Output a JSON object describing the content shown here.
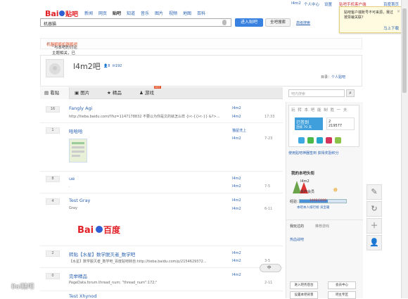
{
  "userbar": {
    "user": "l4m2",
    "center": "个人中心",
    "settings": "设置",
    "client": "贴吧手机客户端",
    "home": "百度首页"
  },
  "logo": {
    "text": "Bai贴吧"
  },
  "nav": [
    "新闻",
    "网页",
    "贴吧",
    "知道",
    "音乐",
    "图片",
    "视频",
    "地图",
    "百科"
  ],
  "search": {
    "value": "机器猫",
    "enter_label": "进入贴吧",
    "all_label": "全吧搜索",
    "advanced": "高级搜索"
  },
  "tip": {
    "text": "贴吧客户端账号不可来源，赛过按票裁关联?",
    "close": "×",
    "go": "马上下载"
  },
  "notice": {
    "prefix": "“",
    "highlight": "机器鹂鹂",
    "text": "”与本吧的讨论主题相关，已为您自动跳转；若您寻找的不是本吧，也可以创建",
    "link": "机器鹂吧",
    "close": "×"
  },
  "forum": {
    "name": "l4m2吧",
    "members": "8",
    "posts": "192",
    "dir_label": "目录：",
    "dir_value": "个人贴吧"
  },
  "tabs": {
    "posts": "看贴",
    "pics": "图片",
    "good": "精品",
    "game": "游戏",
    "hot": "HOT"
  },
  "post_search": {
    "placeholder": "吧内搜索",
    "icon": "search-icon"
  },
  "threads": [
    {
      "reply": "16",
      "title": "Fangly Agi",
      "abstract": "http://tieba.baidu.com/f?kz=1147178832 不要以为你是文的就怎么样 {i<-{{i<-}} &?>...",
      "author": "l4m2",
      "last": "l4m2",
      "time": "17:33"
    },
    {
      "reply": "1",
      "title": "哈哈哈",
      "abstract": "",
      "author": "猫屋洗上",
      "last": "l4m2",
      "time": "7-23"
    },
    {
      "reply": "8",
      "title": "ue",
      "abstract": ".",
      "author": "l4m2",
      "last": "l4m2",
      "time": "7-5"
    },
    {
      "reply": "4",
      "title": "Test Gray",
      "abstract": "Gray",
      "author": "l4m2",
      "last": "l4m2",
      "time": "6-11"
    },
    {
      "reply": "2",
      "title": "转贴【水星】数学脱灭者_数学吧",
      "abstract": "【水星】数学脱灭者_数学吧_百度贴吧转自:http://tieba.baidu.com/p/2154629372...",
      "author": "l4m2",
      "last": "l4m2",
      "time": "3-5"
    },
    {
      "reply": "0",
      "title": "完举精品",
      "abstract": "PageData.forum.thread_num; \"thread_num\":172;\"",
      "author": "l4m2",
      "last": "",
      "time": "2-11"
    },
    {
      "reply": "",
      "title": "Test Xhynod",
      "abstract": "",
      "author": "",
      "last": "",
      "time": ""
    }
  ],
  "baidu_inline_logo": "Bai百度",
  "sign": {
    "header": "玩 转 本 吧 能 制 胜 一 夫",
    "signed": "已签到",
    "days": "连续 70 天",
    "count": "2",
    "rank": "219577",
    "apps_label": "使用贴吧神器签到",
    "score": "获得奖励积分"
  },
  "my": {
    "header": "我的本吧头衔",
    "user": "l4m2",
    "level": "铁杆会员",
    "exp_label": "经验：",
    "exp": "1466/2000",
    "rank_link": "本吧本人排行榜",
    "baby_link": "贡宝箱"
  },
  "right_tabs": {
    "visited": "我玩过的",
    "recommend": "推荐游戏"
  },
  "hot_rec": "热血战吧",
  "rbuttons": [
    "进入吧务后台",
    "会员中心",
    "设置本吧背景",
    "吧主专区"
  ],
  "floats": [
    "edit-icon",
    "refresh-icon",
    "plus-icon",
    "user-icon"
  ],
  "ime": "中",
  "watermark": "Bai贴吧"
}
